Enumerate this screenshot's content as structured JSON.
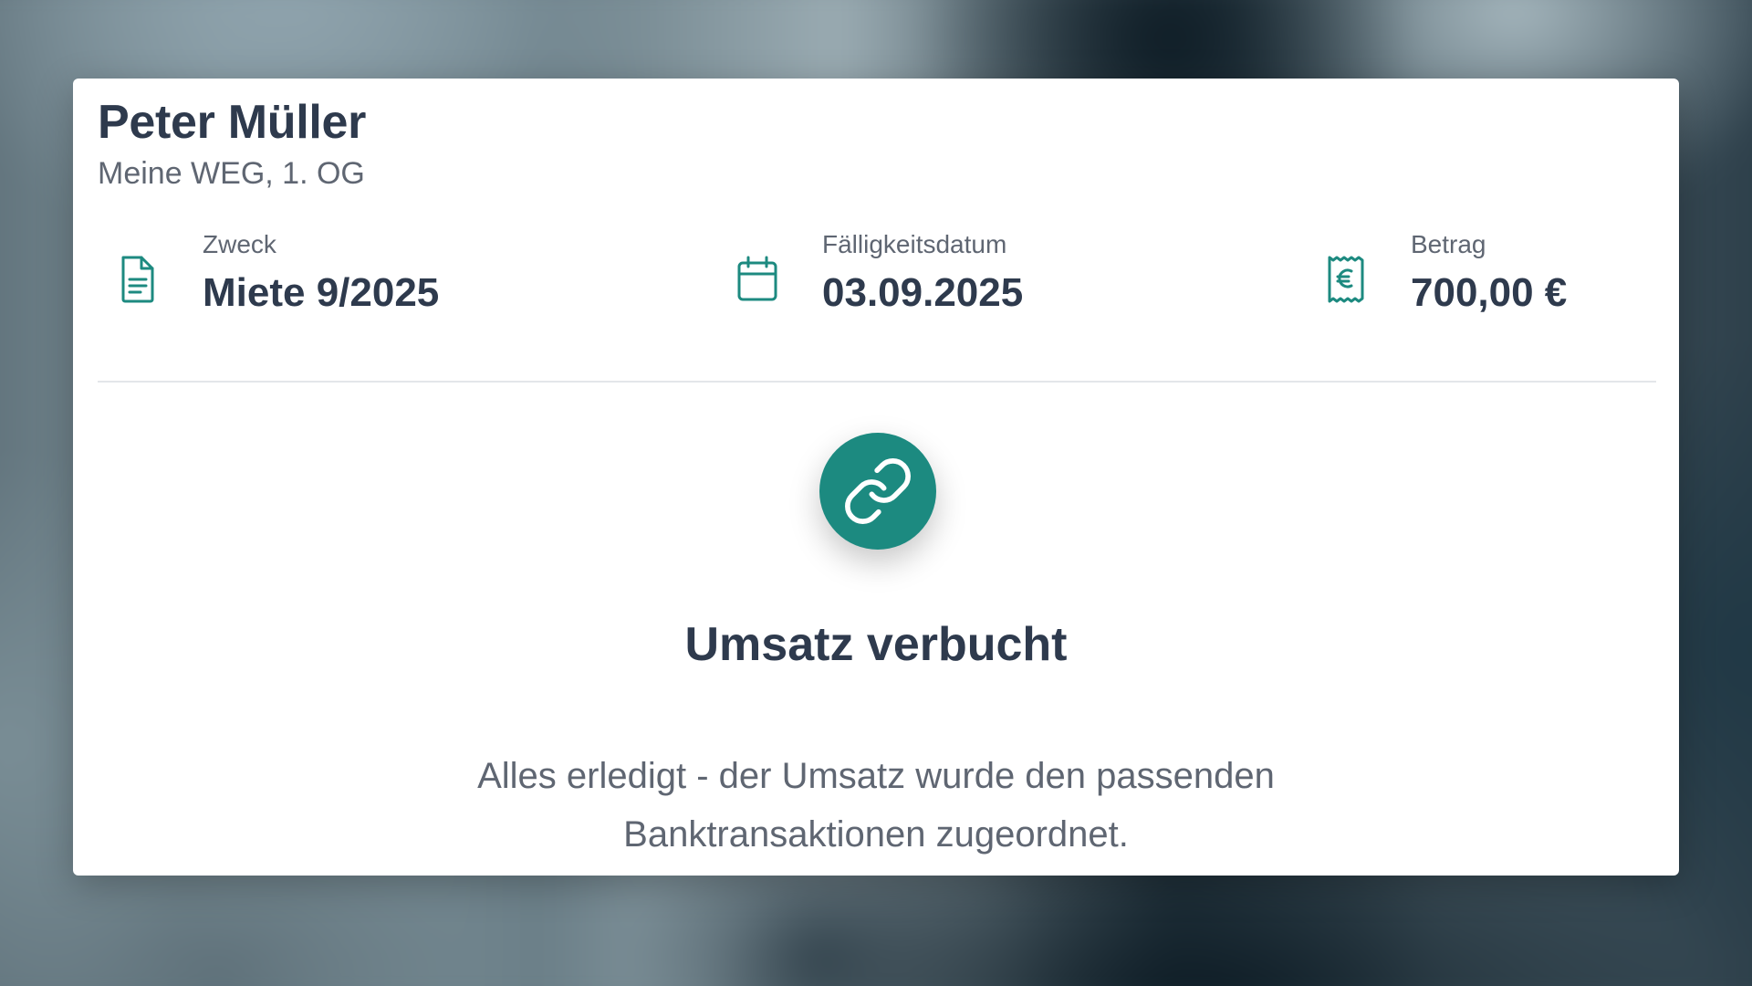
{
  "tenant": {
    "name": "Peter Müller",
    "unit": "Meine WEG, 1. OG"
  },
  "details": [
    {
      "icon": "document-icon",
      "label": "Zweck",
      "value": "Miete 9/2025"
    },
    {
      "icon": "calendar-icon",
      "label": "Fälligkeitsdatum",
      "value": "03.09.2025"
    },
    {
      "icon": "euro-receipt-icon",
      "label": "Betrag",
      "value": "700,00 €"
    }
  ],
  "status": {
    "icon": "link-icon",
    "title": "Umsatz verbucht",
    "message": "Alles erledigt - der Umsatz wurde den passenden Banktransaktionen zugeordnet."
  },
  "colors": {
    "accent": "#1c8a80",
    "heading": "#2e3a4d",
    "muted": "#5f6672"
  }
}
